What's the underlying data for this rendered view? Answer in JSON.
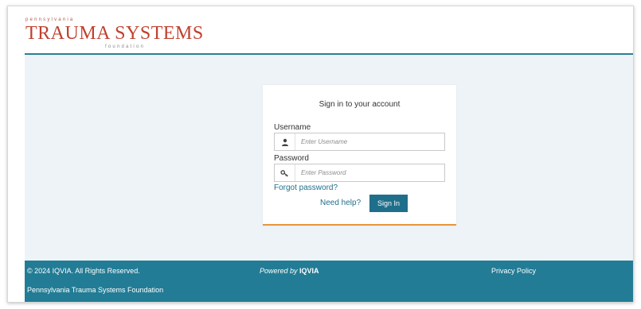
{
  "header": {
    "logo_top": "pennsylvania",
    "logo_main": "TRAUMA SYSTEMS",
    "logo_sub": "foundation"
  },
  "login": {
    "title": "Sign in to your account",
    "username_label": "Username",
    "username_placeholder": "Enter Username",
    "username_value": "",
    "password_label": "Password",
    "password_placeholder": "Enter Password",
    "password_value": "",
    "forgot_password": "Forgot password?",
    "need_help": "Need help?",
    "sign_in": "Sign In"
  },
  "footer": {
    "copyright": "© 2024 IQVIA. All Rights Reserved.",
    "powered_by_prefix": "Powered by",
    "powered_by_brand": "IQVIA",
    "privacy_policy": "Privacy Policy",
    "organization": "Pennsylvania Trauma Systems Foundation"
  },
  "icons": {
    "username": "user-icon",
    "password": "key-icon"
  },
  "colors": {
    "brand_red": "#c0412f",
    "accent_teal": "#227c95",
    "link_blue": "#1f6f8b",
    "card_accent": "#e8963c",
    "page_background": "#eef3f8"
  }
}
